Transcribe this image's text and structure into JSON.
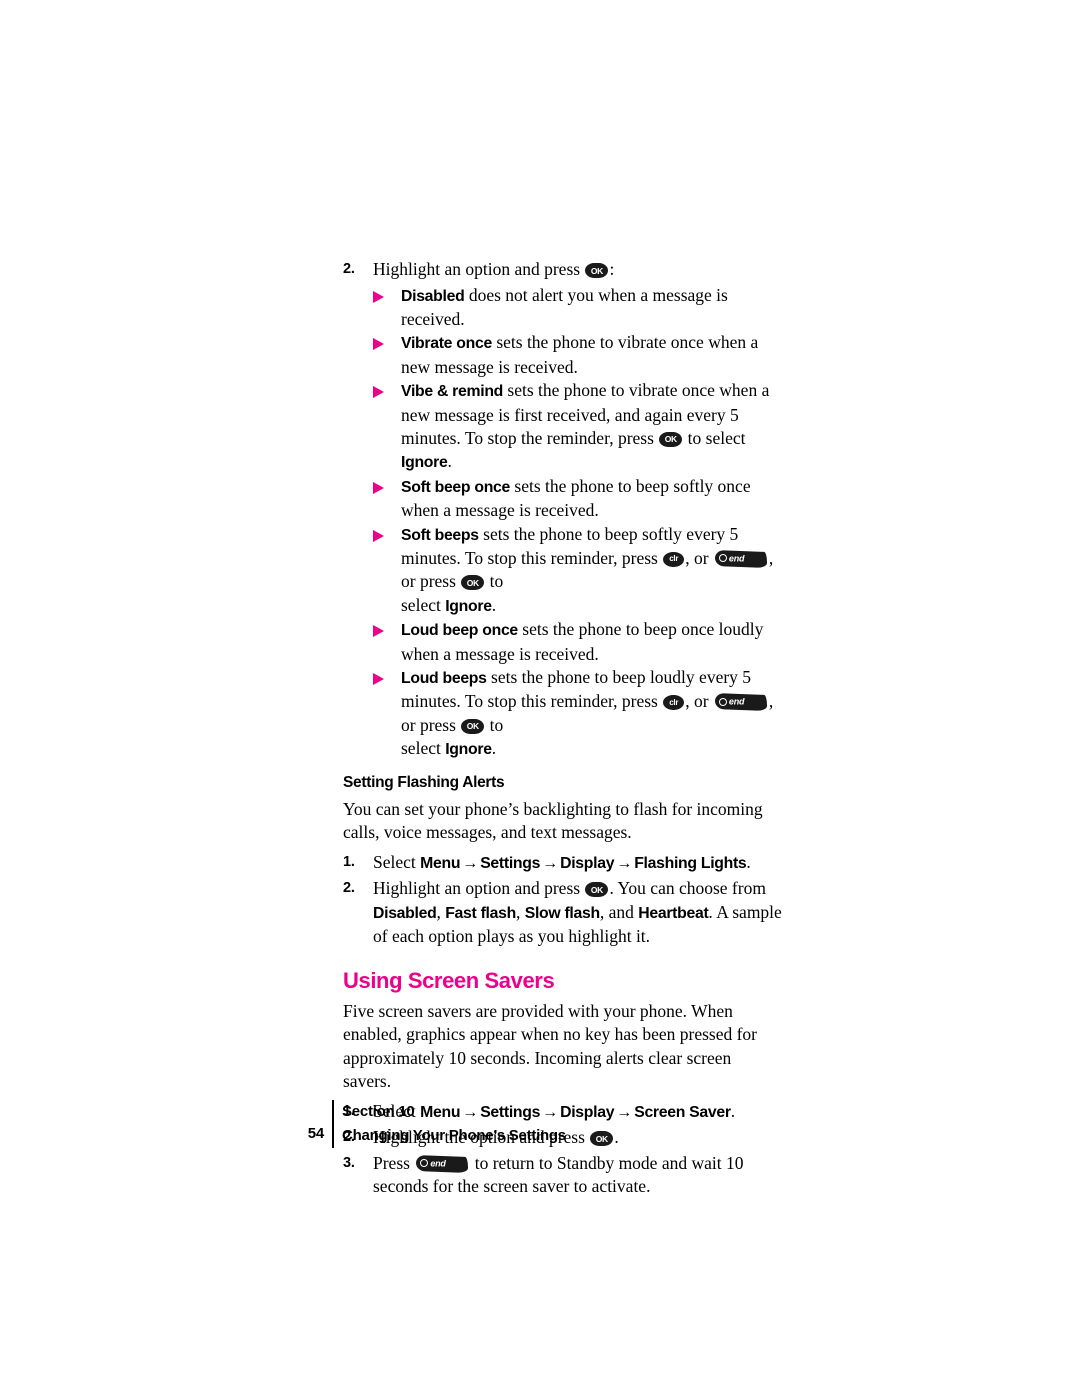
{
  "document": {
    "page_number": "54",
    "footer_section": "Section 10",
    "footer_title": "Changing Your Phone’s Settings"
  },
  "colors": {
    "accent_magenta": "#EC008C",
    "text_black": "#000000",
    "key_black": "#1a1a1a"
  },
  "icons": {
    "ok_key": "OK",
    "clr_key": "clr",
    "end_key": "end",
    "bullet_marker": "triangle-right-icon",
    "menu_arrow": "→"
  },
  "alert_step": {
    "number": "2.",
    "text_before_key": "Highlight an option and press",
    "text_after_key": ":"
  },
  "alert_options": [
    {
      "name": "Disabled",
      "rest": " does not alert you when a message is received."
    },
    {
      "name": "Vibrate once",
      "rest": " sets the phone to vibrate once when a new message is received."
    },
    {
      "name": "Vibe & remind",
      "rest": " sets the phone to vibrate once when a new message is first received, and again every 5 minutes. To stop the reminder, press",
      "after_ok": " to select ",
      "emphasis": "Ignore",
      "tail": "."
    },
    {
      "name": "Soft beep once",
      "rest": " sets the phone to beep softly once when a message is received."
    },
    {
      "name": "Soft beeps",
      "rest": " sets the phone to beep softly every 5 minutes. To stop this reminder, press",
      "mid1": ", or",
      "mid2": ", or press",
      "after_ok": " to",
      "line3_before": "select ",
      "emphasis": "Ignore",
      "tail": "."
    },
    {
      "name": "Loud beep once",
      "rest": " sets the phone to beep once loudly when a message is received."
    },
    {
      "name": "Loud beeps",
      "rest": " sets the phone to beep loudly every 5 minutes. To stop this reminder, press",
      "mid1": ", or",
      "mid2": ", or press",
      "after_ok": " to",
      "line3_before": "select ",
      "emphasis": "Ignore",
      "tail": "."
    }
  ],
  "flashing_alerts": {
    "heading": "Setting Flashing Alerts",
    "intro": "You can set your phone’s backlighting to flash for incoming calls, voice messages, and text messages.",
    "steps": [
      {
        "number": "1.",
        "prefix": "Select ",
        "path": [
          "Menu",
          "Settings",
          "Display",
          "Flashing Lights"
        ],
        "tail": "."
      },
      {
        "number": "2.",
        "before_key": "Highlight an option and press",
        "after_key": ". You can choose from ",
        "options": [
          "Disabled",
          "Fast flash",
          "Slow flash",
          "Heartbeat"
        ],
        "joiner_comma": ", ",
        "joiner_and": ", and ",
        "tail": ". A sample of each option plays as you highlight it."
      }
    ]
  },
  "screen_savers": {
    "heading": "Using Screen Savers",
    "intro": "Five screen savers are provided with your phone. When enabled, graphics appear when no key has been pressed for approximately 10 seconds. Incoming alerts clear screen savers.",
    "steps": [
      {
        "number": "1.",
        "prefix": "Select ",
        "path": [
          "Menu",
          "Settings",
          "Display",
          "Screen Saver"
        ],
        "tail": "."
      },
      {
        "number": "2.",
        "before_key": "Highlight the option and press",
        "after_key": "."
      },
      {
        "number": "3.",
        "before_key": "Press",
        "after_key": " to return to Standby mode and wait 10 seconds for the screen saver to activate."
      }
    ]
  }
}
